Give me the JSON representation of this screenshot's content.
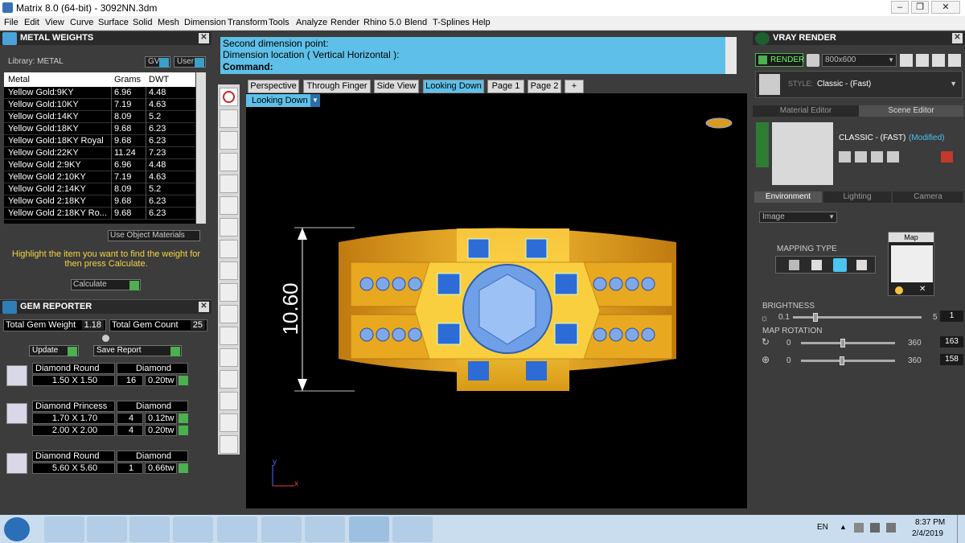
{
  "window": {
    "title": "Matrix 8.0 (64-bit) - 3092NN.3dm"
  },
  "menu": [
    "File",
    "Edit",
    "View",
    "Curve",
    "Surface",
    "Solid",
    "Mesh",
    "Dimension",
    "Transform",
    "Tools",
    "Analyze",
    "Render",
    "Rhino 5.0",
    "Blend",
    "T-Splines",
    "Help"
  ],
  "metal": {
    "title": "METAL WEIGHTS",
    "library": "Library: METAL",
    "gv": "GV",
    "user": "User",
    "headers": [
      "Metal",
      "Grams",
      "DWT"
    ],
    "rows": [
      [
        "Yellow Gold:9KY",
        "6.96",
        "4.48"
      ],
      [
        "Yellow Gold:10KY",
        "7.19",
        "4.63"
      ],
      [
        "Yellow Gold:14KY",
        "8.09",
        "5.2"
      ],
      [
        "Yellow Gold:18KY",
        "9.68",
        "6.23"
      ],
      [
        "Yellow Gold:18KY Royal",
        "9.68",
        "6.23"
      ],
      [
        "Yellow Gold:22KY",
        "11.24",
        "7.23"
      ],
      [
        "Yellow Gold 2:9KY",
        "6.96",
        "4.48"
      ],
      [
        "Yellow Gold 2:10KY",
        "7.19",
        "4.63"
      ],
      [
        "Yellow Gold 2:14KY",
        "8.09",
        "5.2"
      ],
      [
        "Yellow Gold 2:18KY",
        "9.68",
        "6.23"
      ],
      [
        "Yellow Gold 2:18KY Ro...",
        "9.68",
        "6.23"
      ]
    ],
    "use_object": "Use Object Materials",
    "hint": "Highlight the item you want to find the weight for then press Calculate.",
    "calculate": "Calculate"
  },
  "gem": {
    "title": "GEM REPORTER",
    "total_weight_label": "Total Gem Weight",
    "total_weight": "1.18",
    "total_count_label": "Total Gem Count",
    "total_count": "25",
    "update": "Update",
    "save": "Save Report",
    "groups": [
      {
        "shape": "Diamond Round",
        "mat": "Diamond",
        "rows": [
          [
            "1.50 X 1.50",
            "16",
            "0.20tw"
          ]
        ]
      },
      {
        "shape": "Diamond Princess",
        "mat": "Diamond",
        "rows": [
          [
            "1.70 X 1.70",
            "4",
            "0.12tw"
          ],
          [
            "2.00 X 2.00",
            "4",
            "0.20tw"
          ]
        ]
      },
      {
        "shape": "Diamond Round",
        "mat": "Diamond",
        "rows": [
          [
            "5.60 X 5.60",
            "1",
            "0.66tw"
          ]
        ]
      }
    ]
  },
  "command": {
    "line1": "Second dimension point:",
    "line2": "Dimension location ( Vertical  Horizontal ):",
    "line3": "Command:"
  },
  "tabs": [
    "Perspective",
    "Through Finger",
    "Side View",
    "Looking Down",
    "Page 1",
    "Page 2",
    "+"
  ],
  "viewport": {
    "label": "Looking Down",
    "dimension": "10.60",
    "axis_y": "y",
    "axis_x": "x"
  },
  "vray": {
    "title": "VRAY RENDER",
    "render": "RENDER",
    "size": "800x600",
    "style_label": "STYLE:",
    "style": "Classic - (Fast)",
    "tab_material": "Material Editor",
    "tab_scene": "Scene Editor",
    "preset": "CLASSIC - (FAST)",
    "modified": "(Modified)",
    "subtabs": [
      "Environment",
      "Lighting",
      "Camera"
    ],
    "env_type": "Image",
    "mapping": "MAPPING TYPE",
    "map": "Map",
    "brightness": "BRIGHTNESS",
    "b_min": "0.1",
    "b_max": "5",
    "b_val": "1",
    "rotation": "MAP ROTATION",
    "r_min": "0",
    "r_max": "360",
    "r1": "163",
    "r2": "158"
  },
  "taskbar": {
    "lang": "EN",
    "time": "8:37 PM",
    "date": "2/4/2019"
  }
}
